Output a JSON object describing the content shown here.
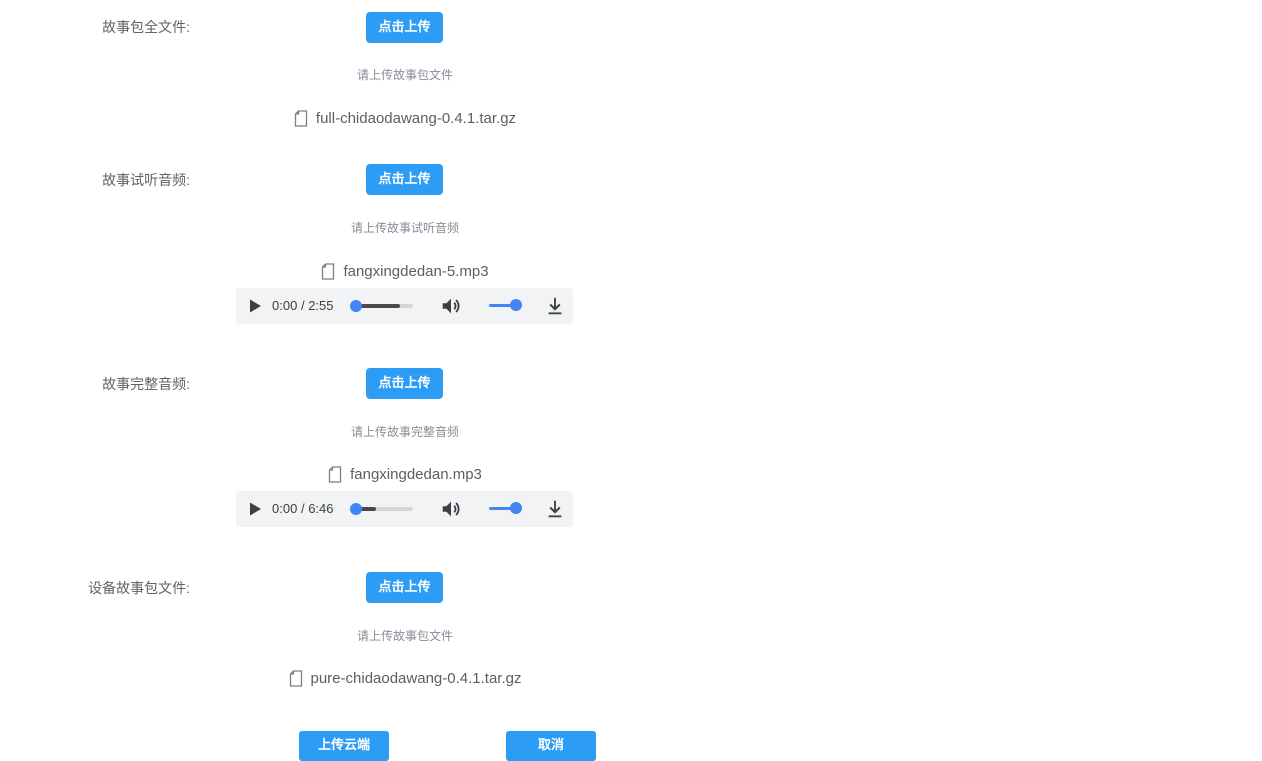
{
  "sections": [
    {
      "label": "故事包全文件:",
      "upload_label": "点击上传",
      "hint": "请上传故事包文件",
      "file_name": "full-chidaodawang-0.4.1.tar.gz"
    },
    {
      "label": "故事试听音频:",
      "upload_label": "点击上传",
      "hint": "请上传故事试听音频",
      "file_name": "fangxingdedan-5.mp3",
      "player": {
        "current": "0:00",
        "separator": "/",
        "duration": "2:55",
        "buffered_fraction": 0.77,
        "volume_fraction": 1.0
      }
    },
    {
      "label": "故事完整音频:",
      "upload_label": "点击上传",
      "hint": "请上传故事完整音频",
      "file_name": "fangxingdedan.mp3",
      "player": {
        "current": "0:00",
        "separator": "/",
        "duration": "6:46",
        "buffered_fraction": 0.35,
        "volume_fraction": 1.0
      }
    },
    {
      "label": "设备故事包文件:",
      "upload_label": "点击上传",
      "hint": "请上传故事包文件",
      "file_name": "pure-chidaodawang-0.4.1.tar.gz"
    }
  ],
  "footer": {
    "submit_label": "上传云端",
    "cancel_label": "取消"
  },
  "icons": {
    "file": "document-icon",
    "play": "play-icon",
    "volume": "volume-icon",
    "download": "download-icon"
  },
  "colors": {
    "primary": "#2d9cf5",
    "player_accent": "#4285f4",
    "player_bg": "#f1f3f4"
  }
}
